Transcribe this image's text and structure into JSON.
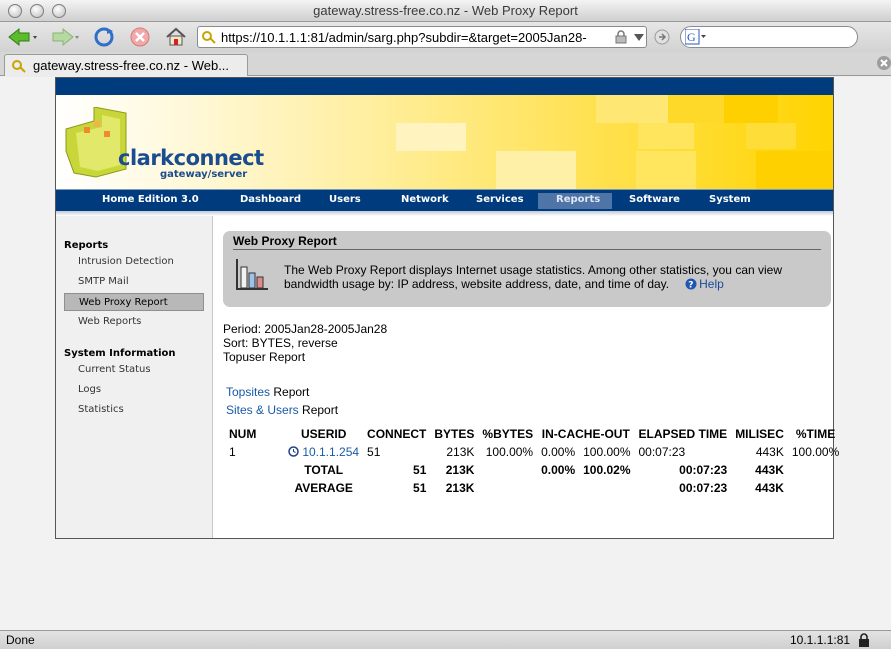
{
  "window": {
    "title": "gateway.stress-free.co.nz - Web Proxy Report"
  },
  "browser": {
    "url": "https://10.1.1.1:81/admin/sarg.php?subdir=&target=2005Jan28-",
    "tab_title": "gateway.stress-free.co.nz - Web...",
    "status": "Done",
    "status_host": "10.1.1.1:81"
  },
  "brand": {
    "name": "clarkconnect",
    "tagline": "gateway/server",
    "edition": "Home Edition 3.0"
  },
  "nav": [
    {
      "label": "Dashboard"
    },
    {
      "label": "Users"
    },
    {
      "label": "Network"
    },
    {
      "label": "Services"
    },
    {
      "label": "Reports"
    },
    {
      "label": "Software"
    },
    {
      "label": "System"
    }
  ],
  "sidebar": {
    "sections": [
      {
        "heading": "Reports",
        "items": [
          "Intrusion Detection",
          "SMTP Mail",
          "Web Proxy Report",
          "Web Reports"
        ]
      },
      {
        "heading": "System Information",
        "items": [
          "Current Status",
          "Logs",
          "Statistics"
        ]
      }
    ],
    "active": "Web Proxy Report"
  },
  "info": {
    "title": "Web Proxy Report",
    "text": "The Web Proxy Report displays Internet usage statistics. Among other statistics, you can view bandwidth usage by: IP address, website address, date, and time of day.",
    "help": "Help"
  },
  "report": {
    "period": "Period: 2005Jan28-2005Jan28",
    "sort": "Sort: BYTES, reverse",
    "topuser": "Topuser Report",
    "links": [
      {
        "link": "Topsites",
        "suffix": " Report"
      },
      {
        "link": "Sites & Users",
        "suffix": " Report"
      }
    ]
  },
  "table": {
    "headers": [
      "NUM",
      "USERID",
      "CONNECT",
      "BYTES",
      "%BYTES",
      "IN-CACHE-OUT",
      "",
      "ELAPSED TIME",
      "MILISEC",
      "%TIME"
    ],
    "row": [
      "1",
      "10.1.1.254",
      "51",
      "213K",
      "100.00%",
      "0.00%",
      "100.00%",
      "00:07:23",
      "443K",
      "100.00%"
    ],
    "total": [
      "",
      "TOTAL",
      "51",
      "213K",
      "",
      "0.00%",
      "100.02%",
      "00:07:23",
      "443K",
      ""
    ],
    "average": [
      "",
      "AVERAGE",
      "51",
      "213K",
      "",
      "",
      "",
      "00:07:23",
      "443K",
      ""
    ]
  }
}
